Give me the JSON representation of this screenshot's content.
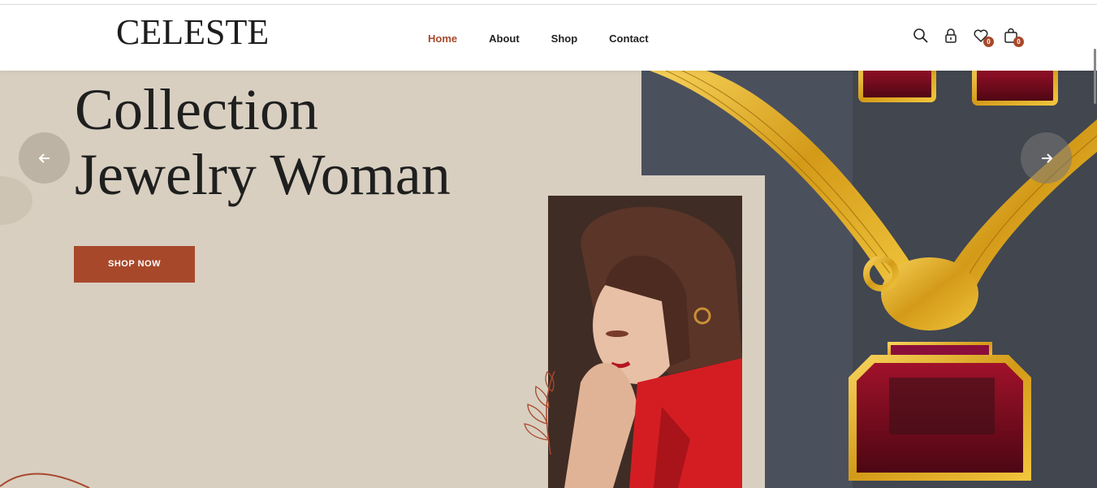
{
  "header": {
    "logo": "CELESTE",
    "nav": [
      {
        "label": "Home",
        "active": true
      },
      {
        "label": "About",
        "active": false
      },
      {
        "label": "Shop",
        "active": false
      },
      {
        "label": "Contact",
        "active": false
      }
    ],
    "icons": {
      "search": "search-icon",
      "account": "lock-icon",
      "wishlist": {
        "icon": "heart-icon",
        "count": "0"
      },
      "cart": {
        "icon": "shopping-bag-icon",
        "count": "0"
      }
    }
  },
  "hero": {
    "title_line1": "Collection",
    "title_line2": "Jewelry Woman",
    "cta": "SHOP NOW"
  },
  "colors": {
    "accent": "#a8482b",
    "hero_bg": "#d8cfc0",
    "text_dark": "#1f1f1f"
  }
}
